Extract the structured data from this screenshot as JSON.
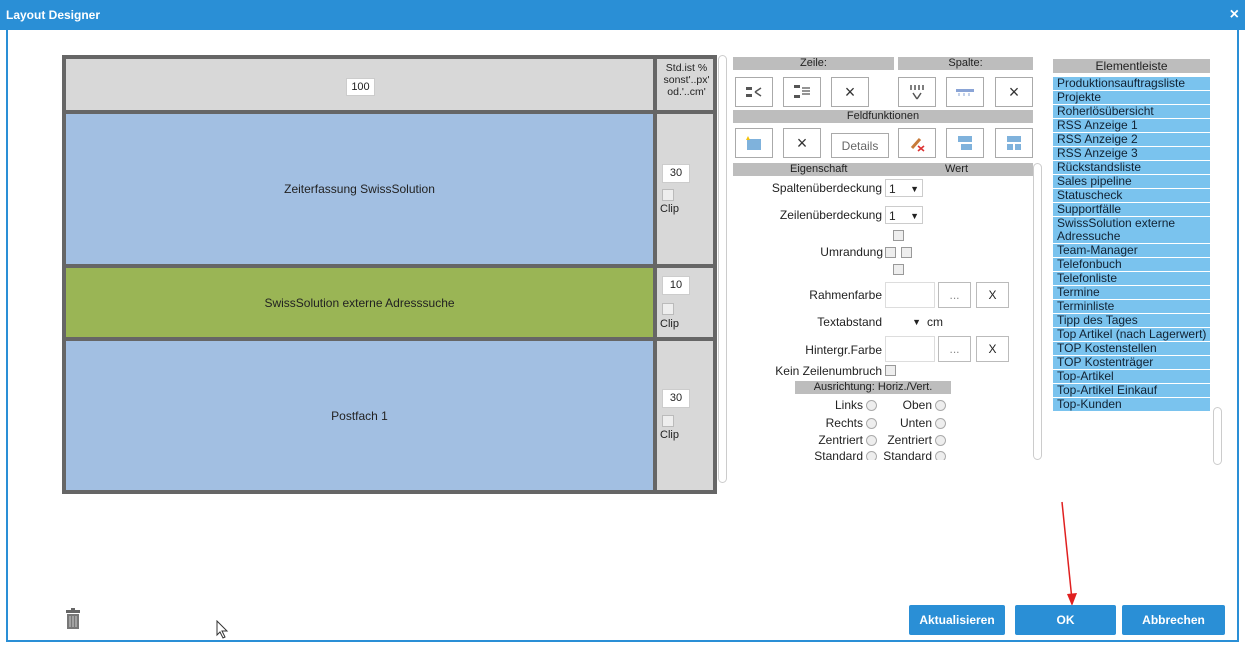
{
  "window": {
    "title": "Layout Designer",
    "close_glyph": "×"
  },
  "grid": {
    "header_width": "100",
    "side_header": "Std.ist % sonst'..px' od.'..cm'",
    "rows": [
      {
        "label": "Zeiterfassung SwissSolution",
        "height": "30",
        "clip": "Clip",
        "color": "#a2bfe2"
      },
      {
        "label": "SwissSolution externe Adresssuche",
        "height": "10",
        "clip": "Clip",
        "color": "#9ab555"
      },
      {
        "label": "Postfach 1",
        "height": "30",
        "clip": "Clip",
        "color": "#a2bfe2"
      }
    ]
  },
  "toolbar": {
    "zeile_label": "Zeile:",
    "spalte_label": "Spalte:",
    "feldfunktionen_label": "Feldfunktionen",
    "details_label": "Details",
    "close_glyph": "×"
  },
  "props": {
    "header_prop": "Eigenschaft",
    "header_val": "Wert",
    "spalten_label": "Spaltenüberdeckung",
    "spalten_value": "1",
    "zeilen_label": "Zeilenüberdeckung",
    "zeilen_value": "1",
    "umrandung_label": "Umrandung",
    "rahmenfarbe_label": "Rahmenfarbe",
    "textabstand_label": "Textabstand",
    "textabstand_unit": "cm",
    "hintergr_label": "Hintergr.Farbe",
    "kein_label": "Kein Zeilenumbruch",
    "ausrichtung_label": "Ausrichtung: Horiz./Vert.",
    "ellipsis": "...",
    "clear": "X",
    "horiz": [
      "Links",
      "Rechts",
      "Zentriert",
      "Standard"
    ],
    "vert": [
      "Oben",
      "Unten",
      "Zentriert",
      "Standard"
    ]
  },
  "elementleiste": {
    "title": "Elementleiste",
    "items": [
      "Produktionsauftragsliste",
      "Projekte",
      "Roherlösübersicht",
      "RSS Anzeige 1",
      "RSS Anzeige 2",
      "RSS Anzeige 3",
      "Rückstandsliste",
      "Sales pipeline",
      "Statuscheck",
      "Supportfälle",
      "SwissSolution externe Adressuche",
      "Team-Manager",
      "Telefonbuch",
      "Telefonliste",
      "Termine",
      "Terminliste",
      "Tipp des Tages",
      "Top Artikel (nach Lagerwert)",
      "TOP Kostenstellen",
      "TOP Kostenträger",
      "Top-Artikel",
      "Top-Artikel Einkauf",
      "Top-Kunden"
    ]
  },
  "footer": {
    "aktualisieren": "Aktualisieren",
    "ok": "OK",
    "abbrechen": "Abbrechen"
  },
  "colors": {
    "accent": "#2a8fd6",
    "list_item": "#7ac3ee",
    "annotation_arrow": "#e02020"
  }
}
